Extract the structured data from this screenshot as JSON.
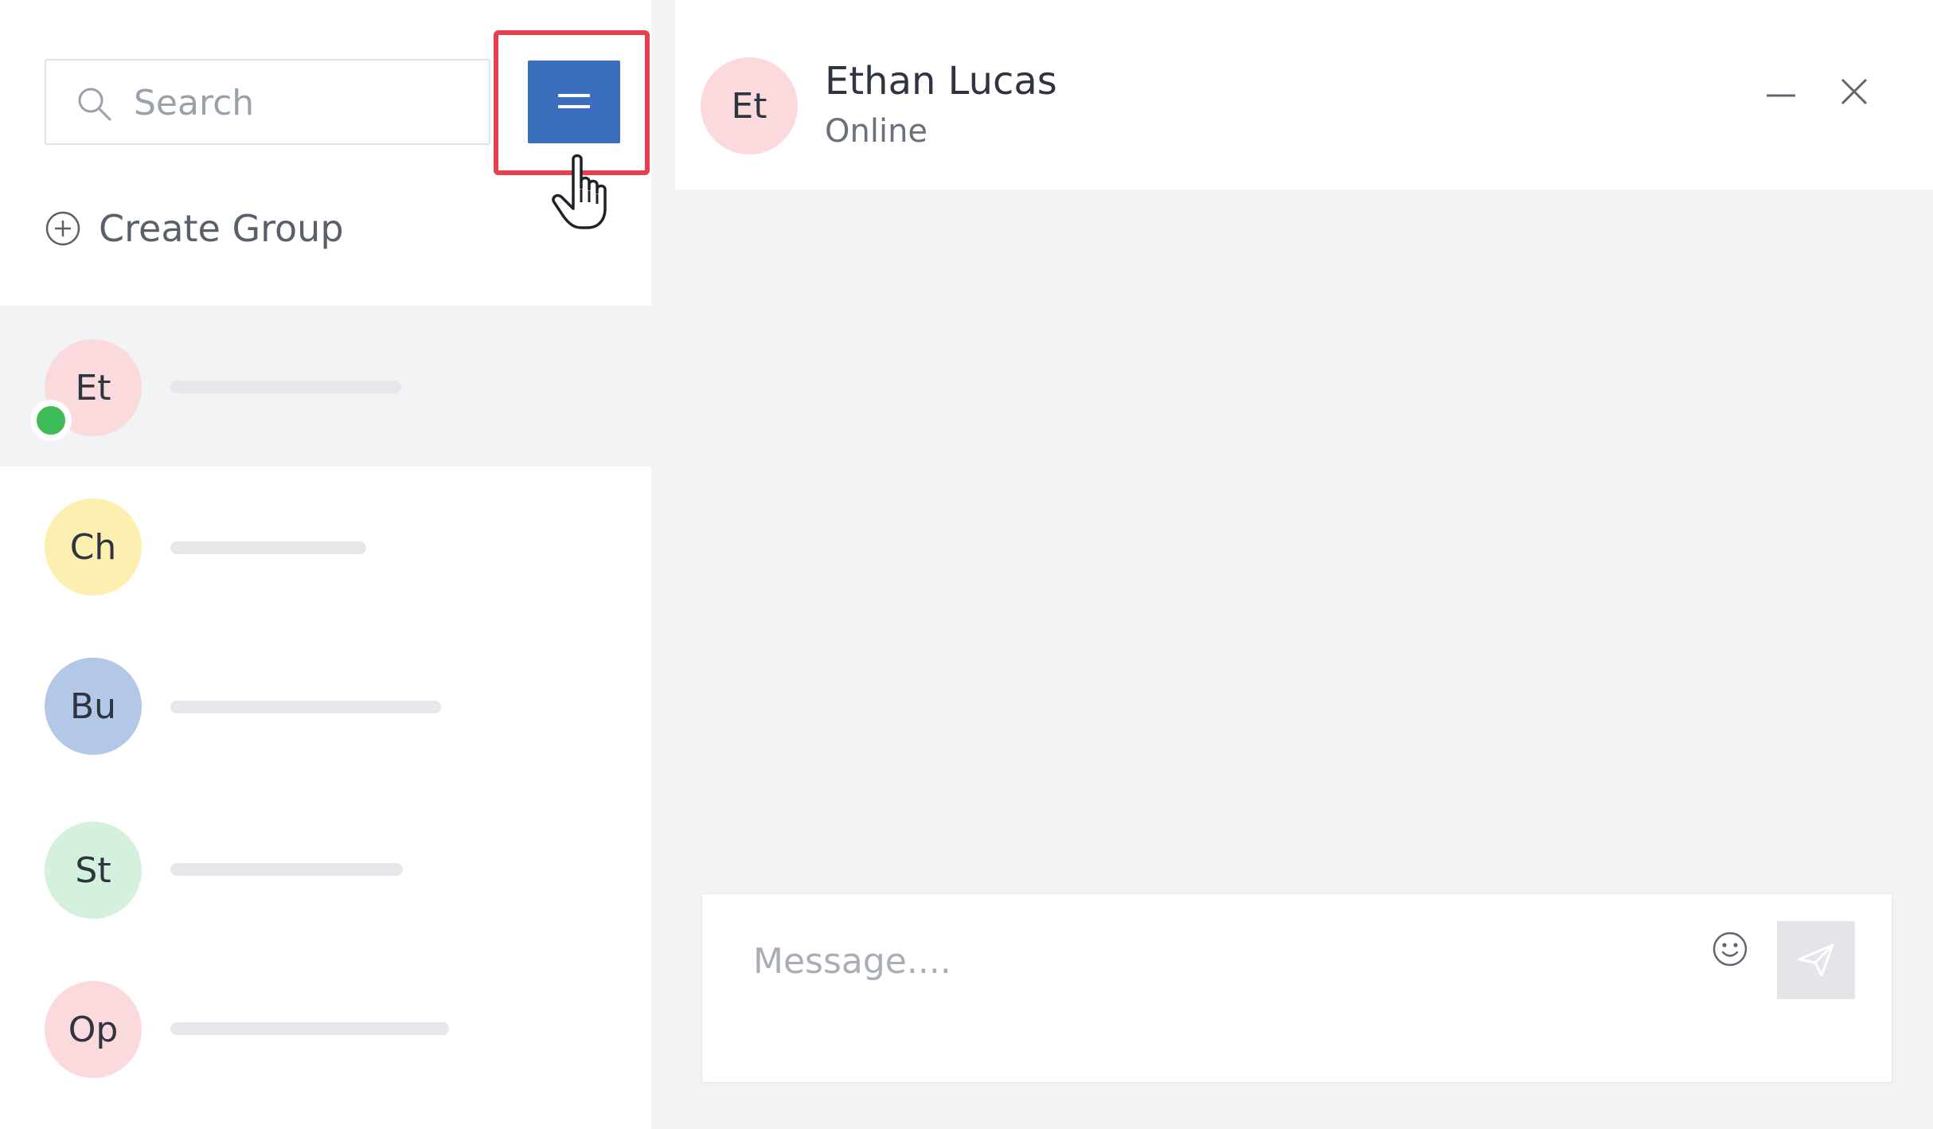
{
  "sidebar": {
    "search": {
      "placeholder": "Search",
      "value": ""
    },
    "menu_button": {
      "icon": "hamburger-menu-icon",
      "color": "#3b6ebd",
      "highlight_color": "#e4404f"
    },
    "create_group": {
      "label": "Create Group",
      "icon": "plus-circle-icon"
    },
    "contacts": [
      {
        "initials": "Et",
        "color": "#fbdadd",
        "online": true,
        "active": true
      },
      {
        "initials": "Ch",
        "color": "#fdefb0",
        "online": false,
        "active": false
      },
      {
        "initials": "Bu",
        "color": "#b3c7e6",
        "online": false,
        "active": false
      },
      {
        "initials": "St",
        "color": "#d3f1dc",
        "online": false,
        "active": false
      },
      {
        "initials": "Op",
        "color": "#fbdadd",
        "online": false,
        "active": false
      }
    ]
  },
  "chat": {
    "header": {
      "avatar_initials": "Et",
      "name": "Ethan Lucas",
      "status": "Online",
      "minimize_icon": "minus-icon",
      "close_icon": "close-icon"
    },
    "composer": {
      "placeholder": "Message....",
      "value": "",
      "emoji_icon": "smiley-icon",
      "send_icon": "paper-plane-icon"
    }
  },
  "colors": {
    "accent": "#3b6ebd",
    "online": "#3dbd5a",
    "panel_bg": "#f2f3f5"
  }
}
